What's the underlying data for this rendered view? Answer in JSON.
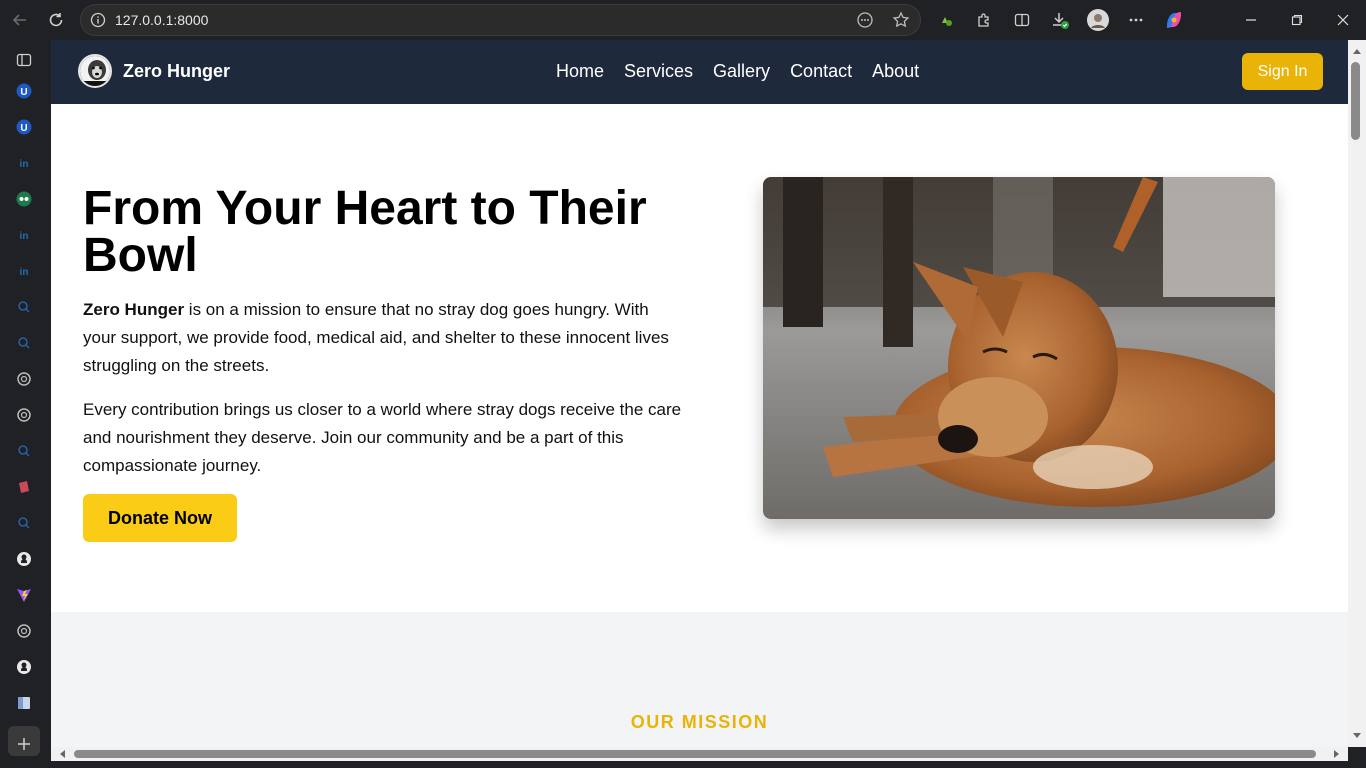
{
  "browser": {
    "url": "127.0.0.1:8000"
  },
  "sidebar": {
    "icons": [
      "panel-icon",
      "upwork-icon",
      "upwork-icon",
      "linkedin-icon",
      "tripadvisor-icon",
      "linkedin-icon",
      "linkedin-icon",
      "search-icon",
      "search-icon",
      "chatgpt-icon",
      "chatgpt-icon",
      "search-icon",
      "bookmark-icon",
      "search-icon",
      "github-icon",
      "vite-icon",
      "chatgpt-icon",
      "github-icon",
      "reader-icon",
      "add-icon"
    ]
  },
  "site": {
    "brand": "Zero Hunger",
    "logo_text": "Street Dog",
    "menu": [
      "Home",
      "Services",
      "Gallery",
      "Contact",
      "About"
    ],
    "signin_label": "Sign In",
    "accent": "#eab308",
    "nav_bg": "#1e293b"
  },
  "hero": {
    "title": "From Your Heart to Their Bowl",
    "p1_strong": "Zero Hunger",
    "p1_rest": " is on a mission to ensure that no stray dog goes hungry. With your support, we provide food, medical aid, and shelter to these innocent lives struggling on the streets.",
    "p2": "Every contribution brings us closer to a world where stray dogs receive the care and nourishment they deserve. Join our community and be a part of this compassionate journey.",
    "donate_label": "Donate Now"
  },
  "mission": {
    "label": "OUR MISSION"
  }
}
